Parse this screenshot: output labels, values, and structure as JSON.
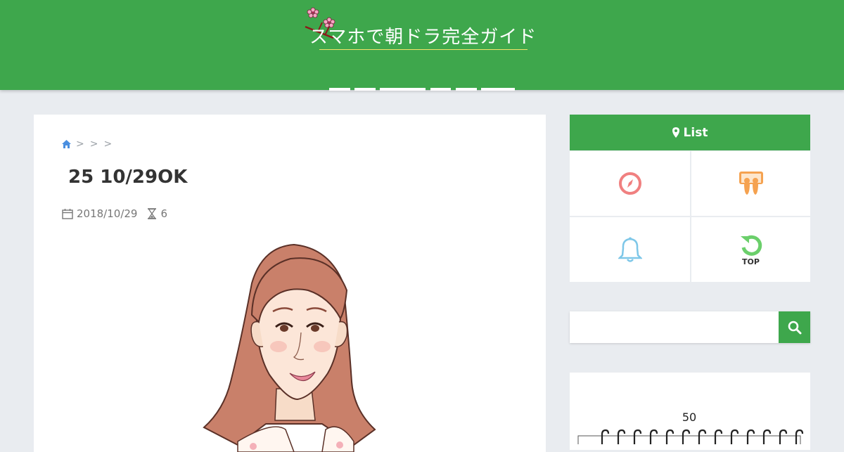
{
  "site": {
    "title": "スマホで朝ドラ完全ガイド",
    "nav_items": [
      "",
      "",
      "",
      "",
      "",
      ""
    ]
  },
  "breadcrumb": {
    "home_icon": "home-icon",
    "separators": [
      ">",
      ">",
      ">"
    ]
  },
  "post": {
    "title": "25 10/29OK",
    "date": "2018/10/29",
    "count": "6",
    "image_icon": "illustration-woman"
  },
  "sidebar": {
    "list_title": "List",
    "tiles": [
      {
        "icon": "compass-icon",
        "label": "",
        "color": "#f08080"
      },
      {
        "icon": "slideshare-icon",
        "label": "",
        "color": "#f5a250"
      },
      {
        "icon": "bell-icon",
        "label": "",
        "color": "#7ec7e8"
      },
      {
        "icon": "refresh-icon",
        "label": "TOP",
        "color": "#6bcf6b"
      }
    ],
    "search": {
      "placeholder": "",
      "value": ""
    },
    "calendar_number": "50"
  },
  "colors": {
    "header_green": "#3ea74c",
    "page_bg": "#e9ecf0",
    "accent_yellow": "#f4e46a"
  }
}
